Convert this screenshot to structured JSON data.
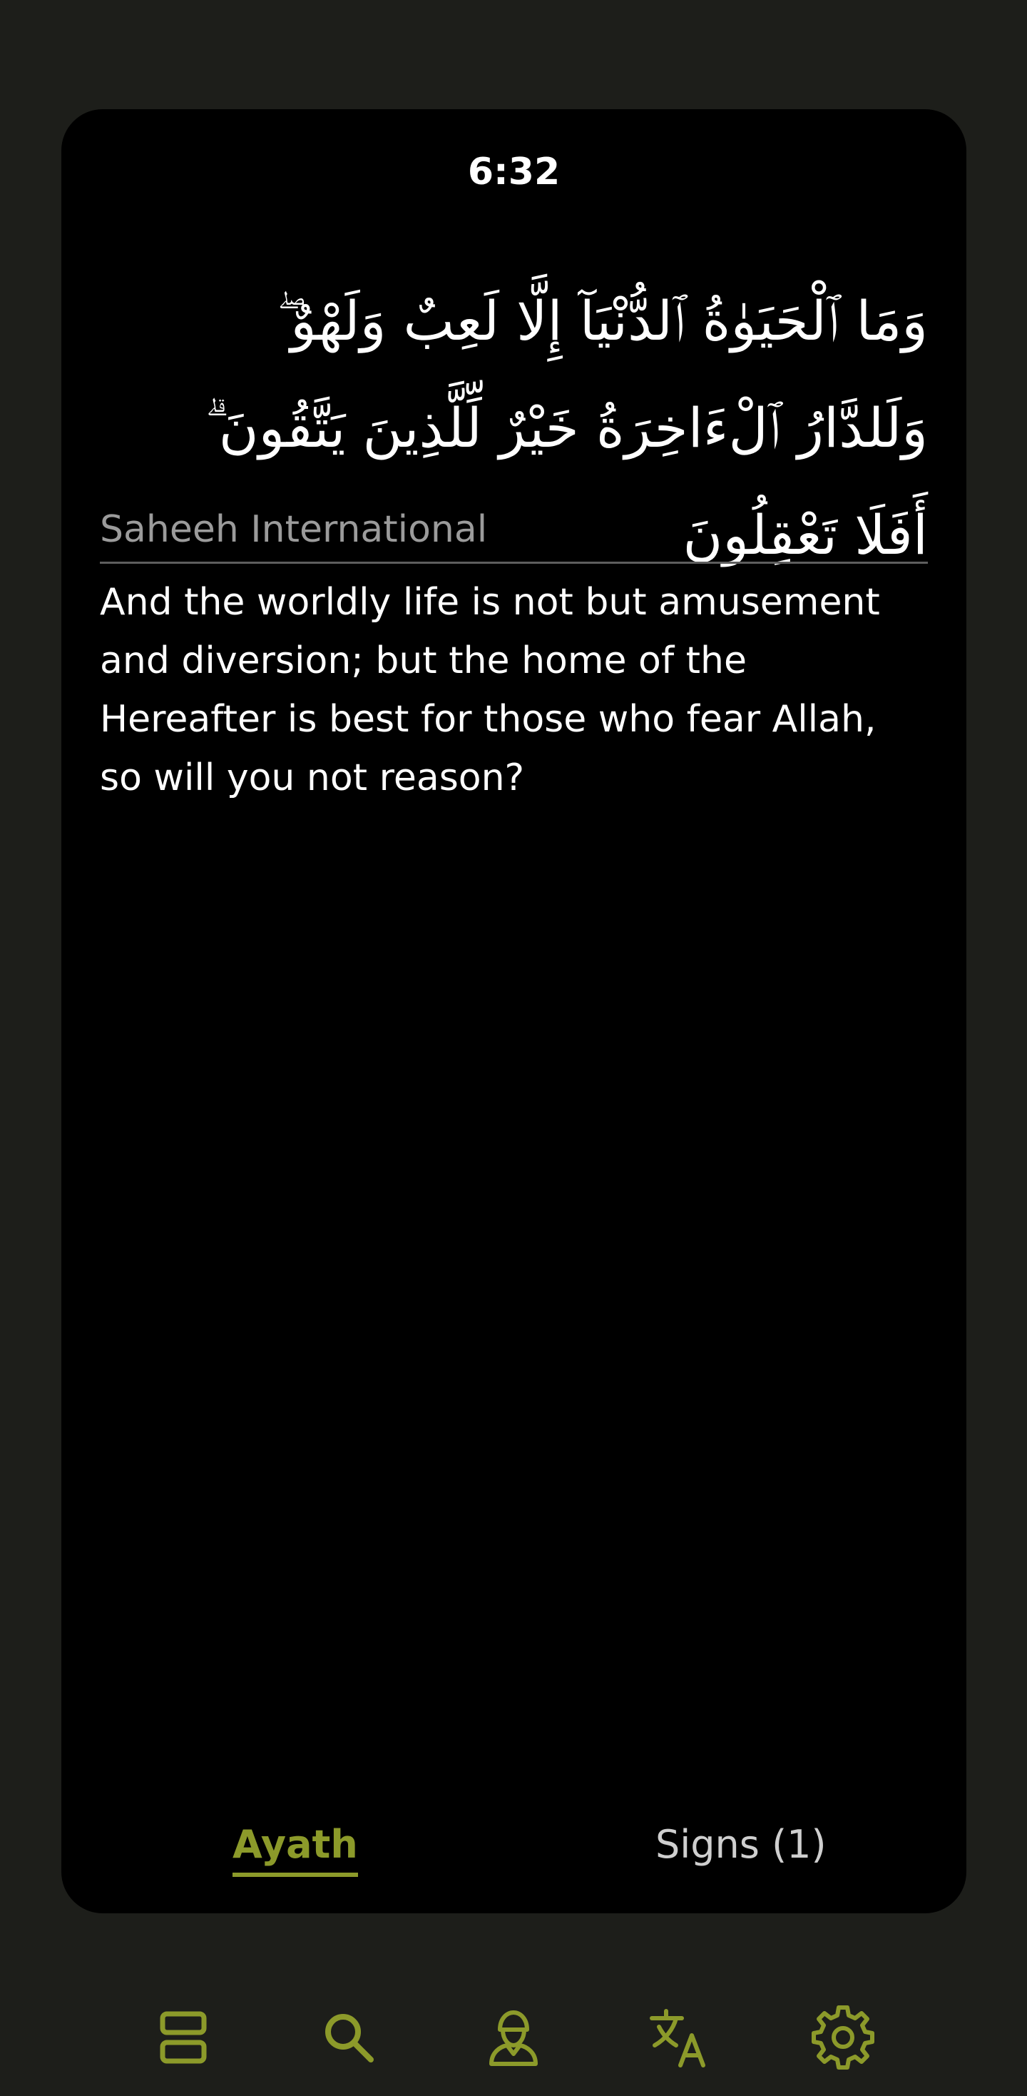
{
  "status": {
    "time": "6:32"
  },
  "verse": {
    "arabic": "وَمَا ٱلْحَيَوٰةُ ٱلدُّنْيَآ إِلَّا لَعِبٌ وَلَهْوٌ ۖ وَلَلدَّارُ ٱلْءَاخِرَةُ خَيْرٌ لِّلَّذِينَ يَتَّقُونَ ۗ أَفَلَا تَعْقِلُونَ",
    "translator": "Saheeh International",
    "translation": "And the worldly life is not but amusement and diversion; but the home of the Hereafter is best for those who fear Allah, so will you not reason?"
  },
  "tabs": [
    {
      "label": "Ayath",
      "active": true
    },
    {
      "label": "Signs (1)",
      "active": false
    }
  ],
  "bottom_nav": [
    {
      "icon": "list-icon"
    },
    {
      "icon": "search-icon"
    },
    {
      "icon": "person-icon"
    },
    {
      "icon": "translate-icon"
    },
    {
      "icon": "settings-icon"
    }
  ],
  "colors": {
    "background": "#1d1e1a",
    "card": "#000000",
    "accent": "#8c9a2a",
    "text": "#ffffff",
    "muted": "#9b9b9b"
  }
}
